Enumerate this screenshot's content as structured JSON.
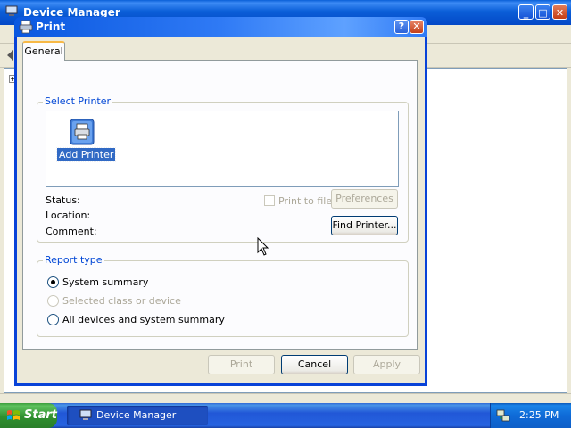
{
  "background_window": {
    "title": "Device Manager",
    "tree_expander": "+"
  },
  "dialog": {
    "title": "Print",
    "help_glyph": "?",
    "close_glyph": "✕",
    "tabs": [
      {
        "label": "General",
        "selected": true
      }
    ],
    "select_printer": {
      "group_label": "Select Printer",
      "items": [
        {
          "label": "Add Printer",
          "icon": "add-printer-icon",
          "selected": true
        }
      ],
      "status_label": "Status:",
      "location_label": "Location:",
      "comment_label": "Comment:",
      "print_to_file": {
        "label": "Print to file",
        "checked": false,
        "enabled": false
      },
      "preferences_label": "Preferences",
      "find_printer_label": "Find Printer..."
    },
    "report_type": {
      "group_label": "Report type",
      "options": [
        {
          "label": "System summary",
          "selected": true,
          "enabled": true
        },
        {
          "label": "Selected class or device",
          "selected": false,
          "enabled": false
        },
        {
          "label": "All devices and system summary",
          "selected": false,
          "enabled": true
        }
      ]
    },
    "buttons": {
      "print_label": "Print",
      "cancel_label": "Cancel",
      "apply_label": "Apply"
    }
  },
  "taskbar": {
    "start_label": "Start",
    "tasks": [
      {
        "label": "Device Manager",
        "active": true
      }
    ],
    "clock": "2:25 PM"
  },
  "colors": {
    "selection": "#316ac5",
    "group_label": "#0046d5",
    "titlebar": "#0a58e0",
    "taskbar": "#2157d7",
    "start_button": "#2f8f2f"
  }
}
